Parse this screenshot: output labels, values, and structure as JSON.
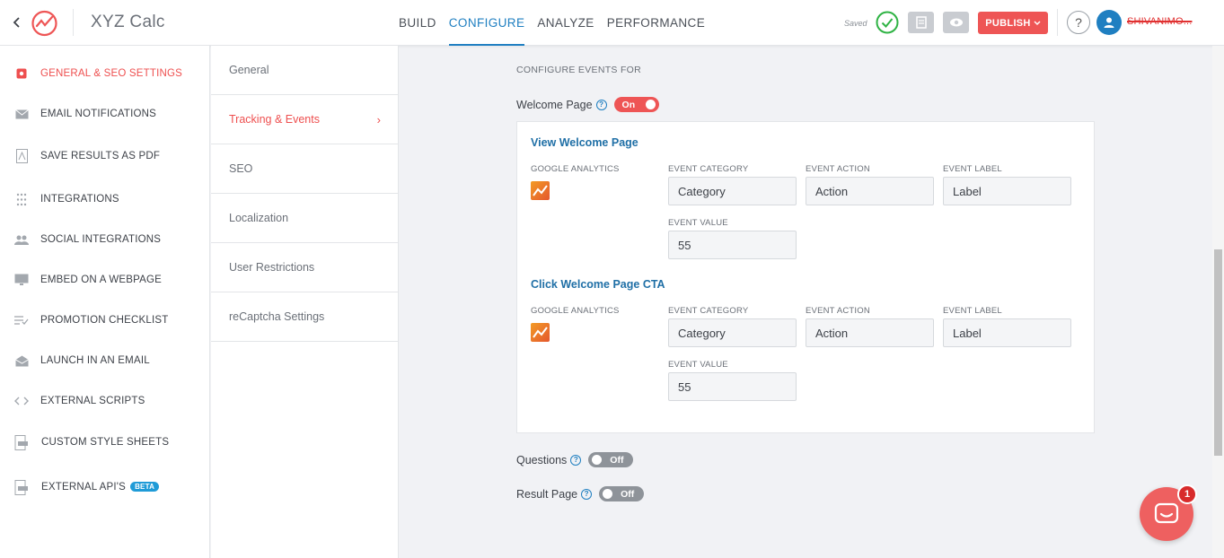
{
  "app": {
    "title": "XYZ Calc"
  },
  "nav": {
    "tabs": [
      "BUILD",
      "CONFIGURE",
      "ANALYZE",
      "PERFORMANCE"
    ],
    "active": "CONFIGURE"
  },
  "header": {
    "saved_label": "Saved",
    "publish_label": "PUBLISH",
    "help_label": "?",
    "username": "SHIVANIMO..."
  },
  "sidebar": {
    "items": [
      {
        "label": "GENERAL & SEO SETTINGS",
        "icon": "settings-square-icon",
        "active": true
      },
      {
        "label": "EMAIL NOTIFICATIONS",
        "icon": "envelope-icon"
      },
      {
        "label": "SAVE RESULTS AS PDF",
        "icon": "pdf-icon"
      },
      {
        "label": "INTEGRATIONS",
        "icon": "dots-grid-icon"
      },
      {
        "label": "SOCIAL INTEGRATIONS",
        "icon": "people-icon"
      },
      {
        "label": "EMBED ON A WEBPAGE",
        "icon": "monitor-icon"
      },
      {
        "label": "PROMOTION CHECKLIST",
        "icon": "checklist-icon"
      },
      {
        "label": "LAUNCH IN AN EMAIL",
        "icon": "open-envelope-icon"
      },
      {
        "label": "EXTERNAL SCRIPTS",
        "icon": "code-brackets-icon"
      },
      {
        "label": "CUSTOM STYLE SHEETS",
        "icon": "css-file-icon"
      },
      {
        "label": "EXTERNAL API'S",
        "icon": "api-file-icon",
        "badge": "BETA"
      }
    ]
  },
  "submenu": {
    "items": [
      {
        "label": "General"
      },
      {
        "label": "Tracking & Events",
        "active": true,
        "chevron": "›"
      },
      {
        "label": "SEO"
      },
      {
        "label": "Localization"
      },
      {
        "label": "User Restrictions"
      },
      {
        "label": "reCaptcha Settings"
      }
    ]
  },
  "main": {
    "section_title": "CONFIGURE EVENTS FOR",
    "welcome_toggle": {
      "label": "Welcome Page",
      "state": "On"
    },
    "questions_toggle": {
      "label": "Questions",
      "state": "Off"
    },
    "result_toggle": {
      "label": "Result Page",
      "state": "Off"
    },
    "events": [
      {
        "title": "View Welcome Page",
        "provider_label": "GOOGLE ANALYTICS",
        "category_label": "EVENT CATEGORY",
        "category": "Category",
        "action_label": "EVENT ACTION",
        "action": "Action",
        "label_label": "EVENT LABEL",
        "label": "Label",
        "value_label": "EVENT VALUE",
        "value": "55"
      },
      {
        "title": "Click Welcome Page CTA",
        "provider_label": "GOOGLE ANALYTICS",
        "category_label": "EVENT CATEGORY",
        "category": "Category",
        "action_label": "EVENT ACTION",
        "action": "Action",
        "label_label": "EVENT LABEL",
        "label": "Label",
        "value_label": "EVENT VALUE",
        "value": "55"
      }
    ]
  },
  "chat": {
    "badge_count": "1"
  },
  "colors": {
    "accent_blue": "#1f7fc1",
    "accent_red": "#ee5555",
    "toggle_off": "#8e9399"
  }
}
